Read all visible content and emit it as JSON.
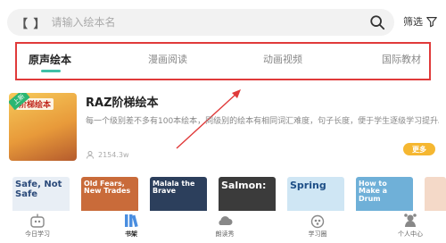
{
  "search": {
    "brackets": "【 】",
    "placeholder": "请输入绘本名"
  },
  "filter": {
    "label": "筛选"
  },
  "tabs": [
    {
      "label": "原声绘本",
      "active": true
    },
    {
      "label": "漫画阅读",
      "active": false
    },
    {
      "label": "动画视频",
      "active": false
    },
    {
      "label": "国际教材",
      "active": false
    }
  ],
  "book": {
    "cover_title": "阶梯绘本",
    "cover_badge": "上新",
    "title": "RAZ阶梯绘本",
    "description": "每一个级别差不多有100本绘本，同级别的绘本有相同词汇难度，句子长度，便于学生逐级学习提升。",
    "views": "2154.3w",
    "more_label": "更多"
  },
  "thumbnails": [
    {
      "text": "Safe, Not Safe",
      "bg": "#e8eef5",
      "fg": "#2b4a7a"
    },
    {
      "text": "Old Fears, New Trades",
      "bg": "#c96b3a",
      "fg": "#ffffff"
    },
    {
      "text": "Malala the Brave",
      "bg": "#2c3f5c",
      "fg": "#ffffff"
    },
    {
      "text": "Salmon:",
      "bg": "#3b3b3b",
      "fg": "#ffffff"
    },
    {
      "text": "Spring",
      "bg": "#cfe6f4",
      "fg": "#1d4e86"
    },
    {
      "text": "How to Make a Drum",
      "bg": "#6fb0d8",
      "fg": "#ffffff"
    },
    {
      "text": "",
      "bg": "#f4d9c8",
      "fg": "#c0271d"
    }
  ],
  "nav": [
    {
      "label": "今日学习",
      "icon": "robot-icon",
      "active": false
    },
    {
      "label": "书架",
      "icon": "bookshelf-icon",
      "active": true
    },
    {
      "label": "朗读秀",
      "icon": "cloud-icon",
      "active": false
    },
    {
      "label": "学习圈",
      "icon": "paw-icon",
      "active": false
    },
    {
      "label": "个人中心",
      "icon": "profile-icon",
      "active": false
    }
  ],
  "colors": {
    "accent": "#3fc0a8",
    "highlight": "#e03a3a",
    "more_button": "#f5b731",
    "nav_active": "#4a8ee0"
  }
}
